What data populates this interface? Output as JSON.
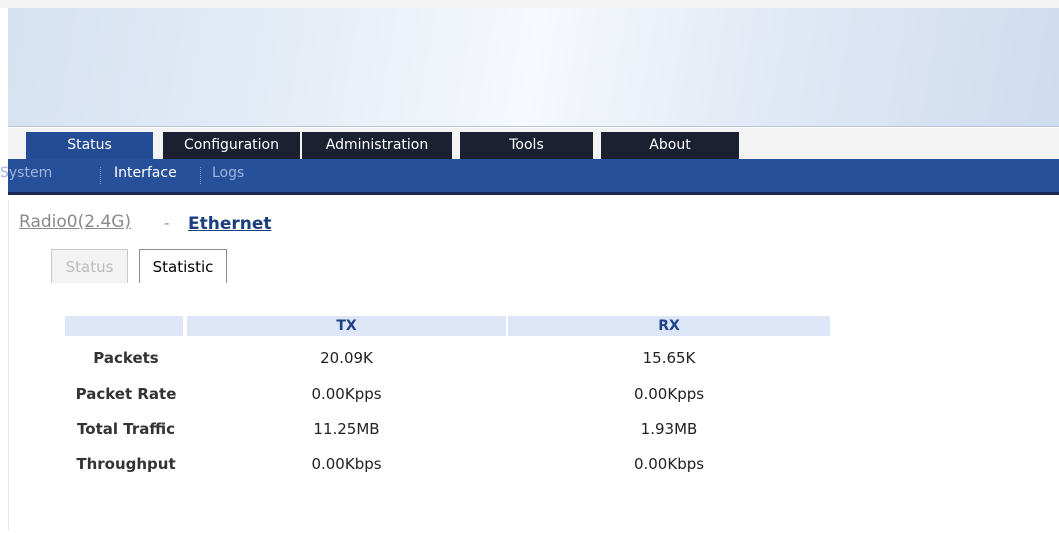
{
  "main_tabs": [
    {
      "label": "Status",
      "active": true
    },
    {
      "label": "Configuration",
      "active": false
    },
    {
      "label": "Administration",
      "active": false
    },
    {
      "label": "Tools",
      "active": false
    },
    {
      "label": "About",
      "active": false
    }
  ],
  "sub_nav": [
    {
      "label": "System",
      "selected": false
    },
    {
      "label": "Interface",
      "selected": true
    },
    {
      "label": "Logs",
      "selected": false
    }
  ],
  "interfaces": {
    "radio": "Radio0(2.4G)",
    "separator": "-",
    "ethernet": "Ethernet"
  },
  "view_tabs": [
    {
      "label": "Status",
      "active": false
    },
    {
      "label": "Statistic",
      "active": true
    }
  ],
  "stats": {
    "headers": {
      "tx": "TX",
      "rx": "RX"
    },
    "rows": [
      {
        "label": "Packets",
        "tx": "20.09K",
        "rx": "15.65K"
      },
      {
        "label": "Packet Rate",
        "tx": "0.00Kpps",
        "rx": "0.00Kpps"
      },
      {
        "label": "Total Traffic",
        "tx": "11.25MB",
        "rx": "1.93MB"
      },
      {
        "label": "Throughput",
        "tx": "0.00Kbps",
        "rx": "0.00Kbps"
      }
    ]
  },
  "colors": {
    "nav_dark": "#1c2131",
    "nav_active": "#244c95",
    "subnav_bg": "#27509b",
    "table_header_bg": "#dde6f6",
    "link": "#1b3f7e"
  }
}
